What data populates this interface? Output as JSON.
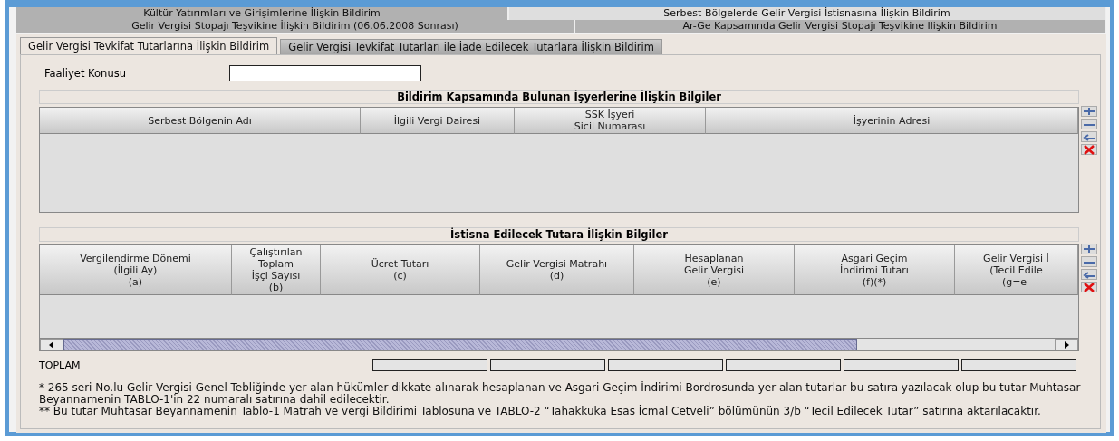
{
  "outer_tab_rows": [
    {
      "tabs": [
        {
          "label": "Kültür Yatırımları ve Girişimlerine İlişkin Bildirim",
          "selected": false
        },
        {
          "label": "Serbest Bölgelerde Gelir Vergisi İstisnasına İlişkin Bildirim",
          "selected": true
        }
      ]
    },
    {
      "tabs": [
        {
          "label": "Gelir Vergisi Stopajı Teşvikine İlişkin Bildirim (06.06.2008 Sonrası)",
          "selected": false
        },
        {
          "label": "Ar-Ge Kapsamında Gelir Vergisi Stopajı Teşvikine Ilişkin Bildirim",
          "selected": false
        }
      ]
    }
  ],
  "inner_tabs": [
    {
      "label": "Gelir Vergisi Tevkifat Tutarlarına İlişkin Bildirim",
      "selected": true
    },
    {
      "label": "Gelir Vergisi Tevkifat Tutarları ile İade Edilecek Tutarlara İlişkin Bildirim",
      "selected": false
    }
  ],
  "faaliyet": {
    "label": "Faaliyet Konusu"
  },
  "workplaces": {
    "title": "Bildirim Kapsamında Bulunan İşyerlerine İlişkin Bilgiler",
    "columns": [
      [
        "Serbest Bölgenin Adı"
      ],
      [
        "İlgili Vergi Dairesi"
      ],
      [
        "SSK İşyeri",
        "Sicil Numarası"
      ],
      [
        "İşyerinin Adresi"
      ]
    ]
  },
  "exemption": {
    "title": "İstisna Edilecek Tutara İlişkin Bilgiler",
    "columns": [
      [
        "Vergilendirme Dönemi",
        "(İlgili Ay)",
        "(a)"
      ],
      [
        "Çalıştırılan",
        "Toplam",
        "İşçi Sayısı",
        "(b)"
      ],
      [
        "Ücret Tutarı",
        "(c)"
      ],
      [
        "Gelir Vergisi Matrahı",
        "(d)"
      ],
      [
        "Hesaplanan",
        "Gelir Vergisi",
        "(e)"
      ],
      [
        "Asgari Geçim",
        "İndirimi Tutarı",
        "(f)(*)"
      ],
      [
        "Gelir Vergisi İ",
        "(Tecil Edile",
        "(g=e-"
      ]
    ]
  },
  "totals": {
    "label": "TOPLAM"
  },
  "footnotes": [
    "* 265 seri No.lu Gelir Vergisi Genel Tebliğinde yer alan hükümler dikkate alınarak hesaplanan ve Asgari Geçim İndirimi Bordrosunda yer alan tutarlar bu satıra yazılacak olup bu tutar Muhtasar Beyannamenin TABLO-1'in 22 numaralı satırına dahil edilecektir.",
    "** Bu tutar Muhtasar Beyannamenin Tablo-1 Matrah ve vergi Bildirimi Tablosuna ve TABLO-2 “Tahakkuka Esas İcmal Cetveli” bölümünün 3/b “Tecil Edilecek Tutar” satırına aktarılacaktır."
  ]
}
